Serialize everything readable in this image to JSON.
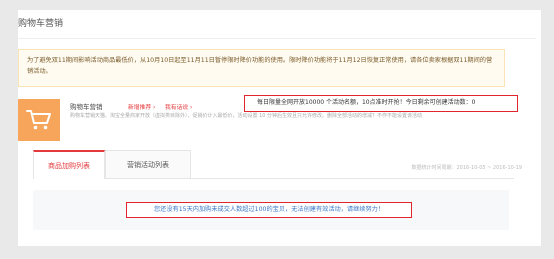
{
  "page": {
    "title": "购物车营销"
  },
  "notice": {
    "text": "为了避免双11期间影响活动商品最低价，从10月10日起至11月11日暂停限时降价功能的使用。限时降价功能将于11月12日恢复正常使用，请各位卖家根据双11期间的营销活动。"
  },
  "app": {
    "icon": "shopping-cart-icon",
    "name": "购物车营销",
    "link_a": "新增推荐 ›",
    "link_b": "我有话说 ›",
    "description": "购物车营销天猫、淘宝全量商家开放（虚拟类目除外），促销价计入最低价，活动设置 10 分钟后生效且只允许修改。删除全部活动的增减？不作不能设置该活动",
    "daily_limit": "每日限量全网开放10000 个活动名额，10点准时开抢！今日剩余可创建活动数：0"
  },
  "tabs": [
    {
      "label": "商品加购列表",
      "active": true
    },
    {
      "label": "营销活动列表",
      "active": false
    }
  ],
  "stats": {
    "range": "数据统计时间周期：2016-10-05 ~ 2016-10-19"
  },
  "empty": {
    "message": "您还没有15天内加购未成交人数超过100的宝贝，无法创建有效活动，请继续努力！"
  },
  "colors": {
    "accent": "#e4393c",
    "icon_bg": "#f6a55a",
    "highlight_border": "#e0262c",
    "link_blue": "#3a78c9"
  }
}
